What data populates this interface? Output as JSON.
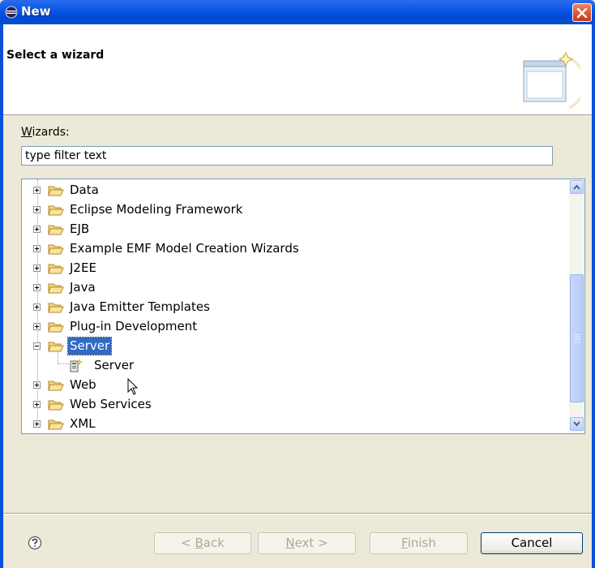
{
  "window": {
    "title": "New",
    "close_icon": "close-icon"
  },
  "header": {
    "title": "Select a wizard",
    "graphic_icon": "new-wizard-graphic"
  },
  "filter": {
    "label_prefix": "W",
    "label_rest": "izards:",
    "value": "type filter text"
  },
  "tree": {
    "items": [
      {
        "label": "Data",
        "expanded": false
      },
      {
        "label": "Eclipse Modeling Framework",
        "expanded": false
      },
      {
        "label": "EJB",
        "expanded": false
      },
      {
        "label": "Example EMF Model Creation Wizards",
        "expanded": false
      },
      {
        "label": "J2EE",
        "expanded": false
      },
      {
        "label": "Java",
        "expanded": false
      },
      {
        "label": "Java Emitter Templates",
        "expanded": false
      },
      {
        "label": "Plug-in Development",
        "expanded": false
      },
      {
        "label": "Server",
        "expanded": true,
        "selected": true
      },
      {
        "label": "Server",
        "child": true
      },
      {
        "label": "Web",
        "expanded": false
      },
      {
        "label": "Web Services",
        "expanded": false
      },
      {
        "label": "XML",
        "expanded": false
      }
    ]
  },
  "buttons": {
    "back_prefix": "< ",
    "back_mnemonic": "B",
    "back_rest": "ack",
    "next_mnemonic": "N",
    "next_rest": "ext >",
    "finish_mnemonic": "F",
    "finish_rest": "inish",
    "cancel": "Cancel"
  },
  "colors": {
    "selection": "#316ac5",
    "titlebar": "#0a58e6",
    "dialog_bg": "#ece9d8"
  }
}
